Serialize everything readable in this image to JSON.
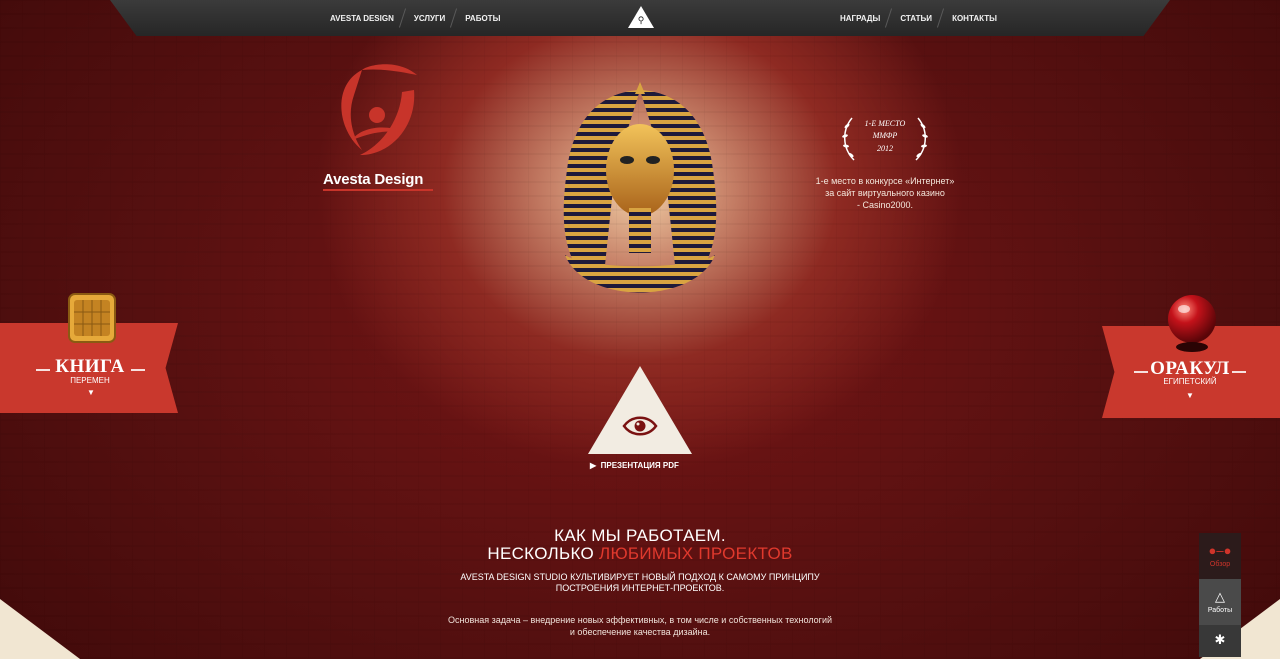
{
  "nav": {
    "left": [
      "AVESTA DESIGN",
      "УСЛУГИ",
      "РАБОТЫ"
    ],
    "right": [
      "НАГРАДЫ",
      "СТАТЬИ",
      "КОНТАКТЫ"
    ],
    "search_icon": "search-icon"
  },
  "logo": {
    "text": "Avesta Design"
  },
  "award": {
    "line1": "1-Е МЕСТО",
    "line2": "ММФР",
    "line3": "2012",
    "desc1": "1-е место в конкурсе «Интернет»",
    "desc2": "за сайт виртуального казино",
    "desc3": "- Casino2000."
  },
  "left_banner": {
    "title": "КНИГА",
    "subtitle": "ПЕРЕМЕН"
  },
  "right_banner": {
    "title": "ОРАКУЛ",
    "subtitle": "ЕГИПЕТСКИЙ"
  },
  "presentation": {
    "label": "ПРЕЗЕНТАЦИЯ PDF"
  },
  "intro": {
    "heading1": "КАК МЫ РАБОТАЕМ.",
    "heading2_prefix": "НЕСКОЛЬКО ",
    "heading2_accent": "ЛЮБИМЫХ ПРОЕКТОВ",
    "lead1": "AVESTA DESIGN STUDIO КУЛЬТИВИРУЕТ НОВЫЙ ПОДХОД К САМОМУ ПРИНЦИПУ",
    "lead2": "ПОСТРОЕНИЯ ИНТЕРНЕТ-ПРОЕКТОВ.",
    "body1": "Основная задача – внедрение новых эффективных, в том числе и собственных технологий",
    "body2": "и обеспечение качества дизайна."
  },
  "side_menu": [
    {
      "label": "Обзор",
      "icon": "glasses-icon"
    },
    {
      "label": "Работы",
      "icon": "flask-icon"
    },
    {
      "label": "",
      "icon": "network-icon"
    }
  ],
  "colors": {
    "accent": "#c9382d",
    "nav_bg": "#2f2f2f"
  }
}
